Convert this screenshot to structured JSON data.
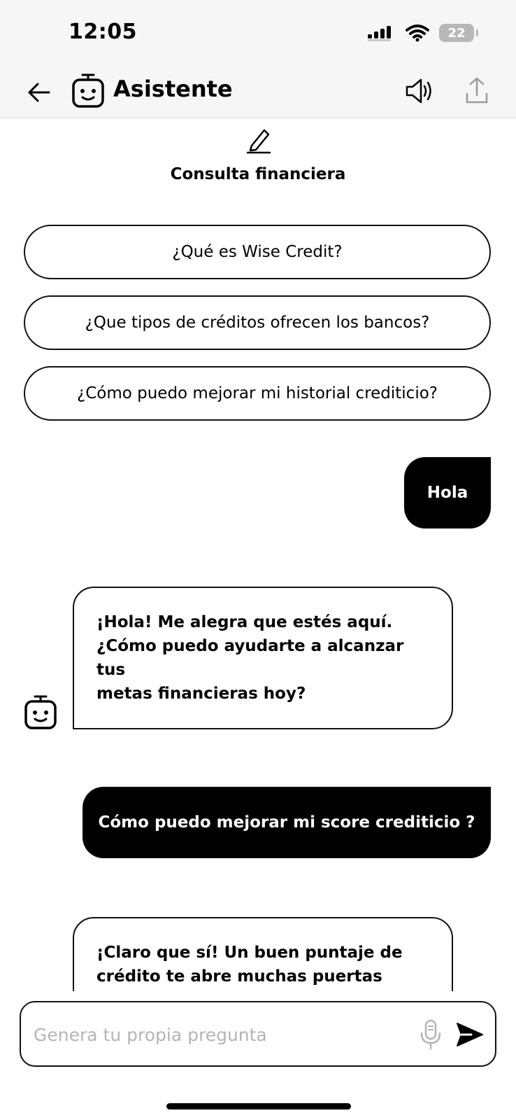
{
  "status_bar": {
    "time": "12:05",
    "battery": "22"
  },
  "header": {
    "title": "Asistente"
  },
  "section": {
    "title": "Consulta financiera"
  },
  "suggestions": [
    "¿Qué es Wise Credit?",
    "¿Que tipos de créditos ofrecen los bancos?",
    "¿Cómo puedo mejorar mi historial crediticio?"
  ],
  "messages": [
    {
      "role": "user",
      "text": "Hola"
    },
    {
      "role": "bot",
      "lines": [
        "¡Hola! Me alegra que estés aquí.",
        "¿Cómo puedo ayudarte a alcanzar tus",
        "metas financieras hoy?"
      ]
    },
    {
      "role": "user",
      "text": "Cómo puedo mejorar mi score crediticio ?"
    },
    {
      "role": "bot",
      "lines": [
        "¡Claro que sí! Un buen puntaje de",
        "crédito te abre muchas puertas"
      ]
    }
  ],
  "composer": {
    "placeholder": "Genera tu propia pregunta"
  },
  "icons": {
    "back": "arrow-left-icon",
    "bot": "robot-face-icon",
    "sound": "speaker-icon",
    "share": "share-icon",
    "edit": "pencil-icon",
    "mic": "microphone-icon",
    "send": "send-icon"
  }
}
